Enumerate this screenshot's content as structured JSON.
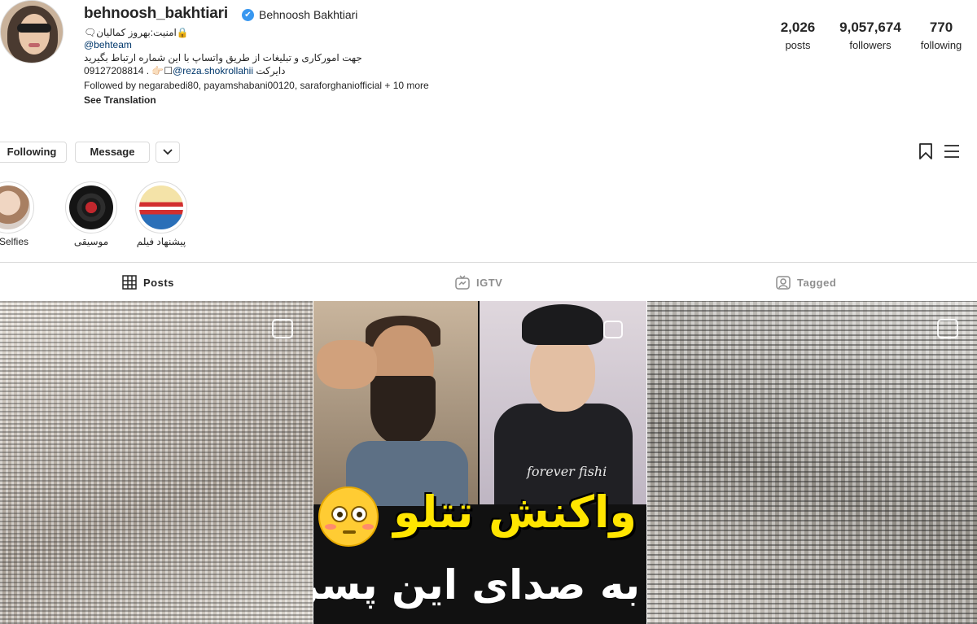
{
  "profile": {
    "username": "behnoosh_bakhtiari",
    "full_name": "Behnoosh Bakhtiari",
    "verified_icon": "✔",
    "bio_line1": "🔒امنیت:بهروز کمالیان🗨",
    "bio_link": "@behteam",
    "bio_line3": "جهت امورکاری و تبلیغات از طریق واتساپ با این شماره ارتباط بگیرید",
    "bio_line4_prefix": "09127208814 . 👉🏻☐",
    "bio_line4_mention": "@reza.shokrollahii",
    "bio_line4_suffix": " دایرکت",
    "followed_by": "Followed by negarabedi80, payamshabani00120, saraforghaniofficial + 10 more",
    "see_translation": "See Translation"
  },
  "stats": {
    "posts_count": "2,026",
    "posts_label": "posts",
    "followers_count": "9,057,674",
    "followers_label": "followers",
    "following_count": "770",
    "following_label": "following"
  },
  "actions": {
    "following_label": "Following",
    "message_label": "Message"
  },
  "highlights": [
    {
      "label": "Selfies"
    },
    {
      "label": "موسیقی"
    },
    {
      "label": "پیشنهاد فیلم"
    }
  ],
  "tabs": [
    {
      "label": "Posts",
      "active": true
    },
    {
      "label": "IGTV",
      "active": false
    },
    {
      "label": "Tagged",
      "active": false
    }
  ],
  "posts": {
    "center_caption_line1": "واکنش تتلو",
    "center_caption_line2": "به صدای این پسر",
    "shirt_text": "forever fishi"
  },
  "colors": {
    "link": "#00376b",
    "verified": "#3897f0",
    "caption_yellow": "#ffe500",
    "border": "#dbdbdb"
  }
}
